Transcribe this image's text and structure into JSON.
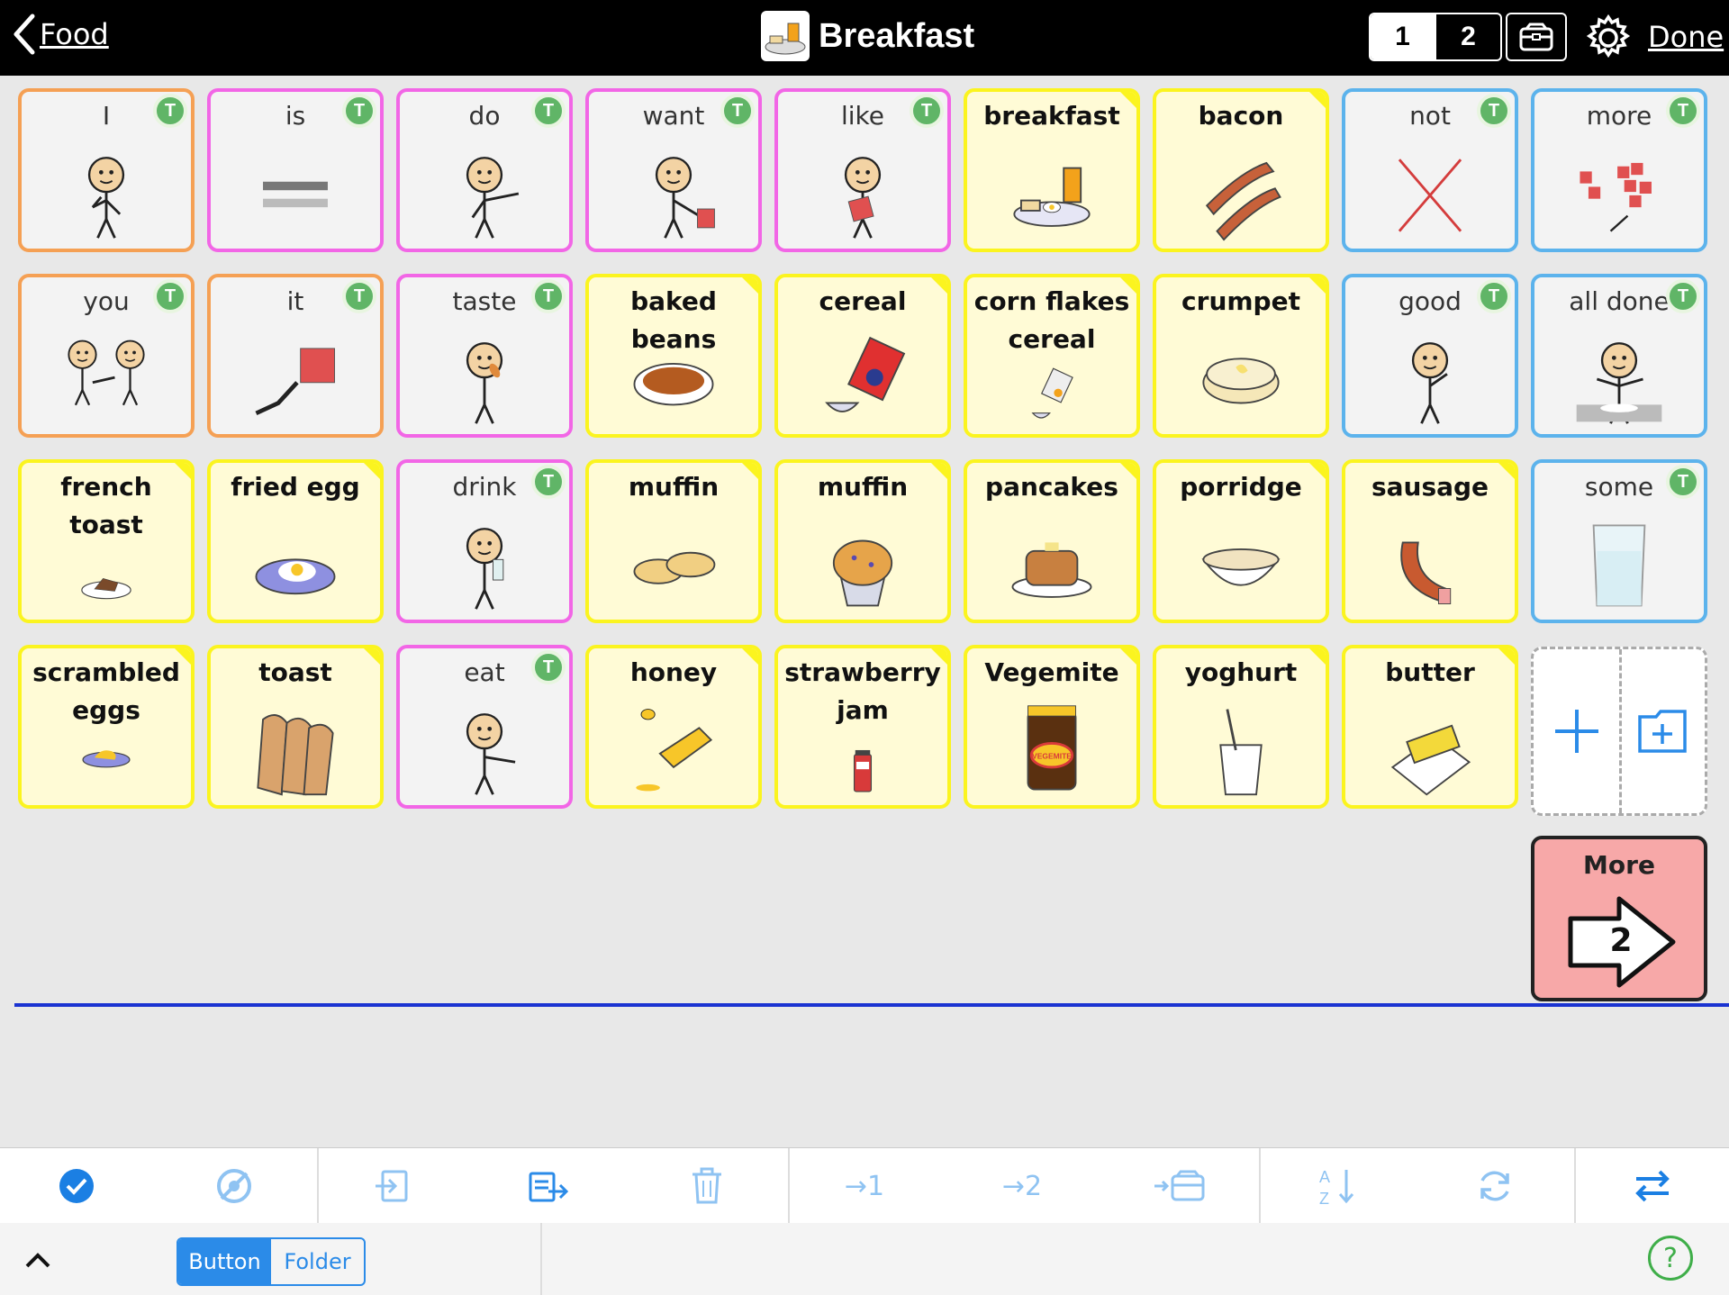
{
  "header": {
    "back_label": "Food",
    "title": "Breakfast",
    "pages": [
      "1",
      "2"
    ],
    "done_label": "Done"
  },
  "colors": {
    "core_orange": "#f5a054",
    "core_pink": "#f266e6",
    "core_blue": "#5cb3ec",
    "food_yellow": "#fbf41f",
    "more_pink": "#f7a8a8",
    "accent_blue": "#2b8be8"
  },
  "grid": {
    "cells": [
      {
        "label": "I",
        "type": "core",
        "color": "orange",
        "pic": "person-pointing-self",
        "badge": "T"
      },
      {
        "label": "is",
        "type": "core",
        "color": "pink",
        "pic": "equals-sign",
        "badge": "T"
      },
      {
        "label": "do",
        "type": "core",
        "color": "pink",
        "pic": "person-doing",
        "badge": "T"
      },
      {
        "label": "want",
        "type": "core",
        "color": "pink",
        "pic": "person-want",
        "badge": "T"
      },
      {
        "label": "like",
        "type": "core",
        "color": "pink",
        "pic": "person-like",
        "badge": "T"
      },
      {
        "label": "breakfast",
        "type": "food",
        "pic": "breakfast-plate"
      },
      {
        "label": "bacon",
        "type": "food",
        "pic": "bacon"
      },
      {
        "label": "not",
        "type": "core",
        "color": "blue",
        "pic": "red-cross",
        "badge": "T"
      },
      {
        "label": "more",
        "type": "core",
        "color": "blue",
        "pic": "more-squares",
        "badge": "T"
      },
      {
        "label": "you",
        "type": "core",
        "color": "orange",
        "pic": "person-pointing-other",
        "badge": "T"
      },
      {
        "label": "it",
        "type": "core",
        "color": "orange",
        "pic": "hand-pointing-square",
        "badge": "T"
      },
      {
        "label": "taste",
        "type": "core",
        "color": "pink",
        "pic": "person-tasting",
        "badge": "T"
      },
      {
        "label": "baked beans",
        "type": "food",
        "pic": "baked-beans"
      },
      {
        "label": "cereal",
        "type": "food",
        "pic": "cereal-box"
      },
      {
        "label": "corn flakes cereal",
        "type": "food",
        "pic": "corn-flakes"
      },
      {
        "label": "crumpet",
        "type": "food",
        "pic": "crumpet"
      },
      {
        "label": "good",
        "type": "core",
        "color": "blue",
        "pic": "person-thumbs-up",
        "badge": "T"
      },
      {
        "label": "all done",
        "type": "core",
        "color": "blue",
        "pic": "person-all-done",
        "badge": "T"
      },
      {
        "label": "french toast",
        "type": "food",
        "pic": "french-toast"
      },
      {
        "label": "fried egg",
        "type": "food",
        "pic": "fried-egg"
      },
      {
        "label": "drink",
        "type": "core",
        "color": "pink",
        "pic": "person-drinking",
        "badge": "T"
      },
      {
        "label": "muffin",
        "type": "food",
        "pic": "english-muffin"
      },
      {
        "label": "muffin",
        "type": "food",
        "pic": "blueberry-muffin"
      },
      {
        "label": "pancakes",
        "type": "food",
        "pic": "pancakes"
      },
      {
        "label": "porridge",
        "type": "food",
        "pic": "porridge"
      },
      {
        "label": "sausage",
        "type": "food",
        "pic": "sausage"
      },
      {
        "label": "some",
        "type": "core",
        "color": "blue",
        "pic": "glass",
        "badge": "T"
      },
      {
        "label": "scrambled eggs",
        "type": "food",
        "pic": "scrambled-eggs"
      },
      {
        "label": "toast",
        "type": "food",
        "pic": "toast"
      },
      {
        "label": "eat",
        "type": "core",
        "color": "pink",
        "pic": "person-eating",
        "badge": "T"
      },
      {
        "label": "honey",
        "type": "food",
        "pic": "honey"
      },
      {
        "label": "strawberry jam",
        "type": "food",
        "pic": "jam-jar"
      },
      {
        "label": "Vegemite",
        "type": "food",
        "pic": "vegemite-jar",
        "jar_text": "VEGEMITE"
      },
      {
        "label": "yoghurt",
        "type": "food",
        "pic": "yoghurt"
      },
      {
        "label": "butter",
        "type": "food",
        "pic": "butter"
      }
    ],
    "more_button": {
      "label": "More",
      "page": "2"
    }
  },
  "edit_toolbar": {
    "buttons": [
      {
        "icon": "check-circle-icon"
      },
      {
        "icon": "hide-icon"
      },
      {
        "icon": "move-in-icon"
      },
      {
        "icon": "copy-icon"
      },
      {
        "icon": "trash-icon"
      },
      {
        "label": "→1"
      },
      {
        "label": "→2"
      },
      {
        "icon": "move-to-toolbox-icon"
      },
      {
        "icon": "sort-az-icon"
      },
      {
        "icon": "refresh-icon"
      },
      {
        "icon": "swap-icon"
      }
    ]
  },
  "footer": {
    "segments": [
      "Button",
      "Folder"
    ],
    "selected_segment": "Button",
    "help": "?"
  }
}
